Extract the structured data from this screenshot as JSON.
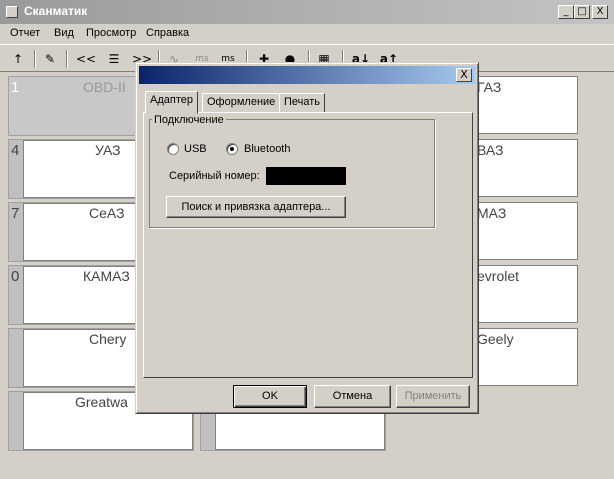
{
  "app": {
    "title": "Сканматик",
    "caption_buttons": [
      "_",
      "□",
      "X"
    ]
  },
  "menu": [
    "Отчет",
    "Вид",
    "Просмотр",
    "Справка"
  ],
  "toolbar": [
    {
      "icon": "up-arrow-icon",
      "glyph": "↑"
    },
    {
      "icon": "edit-icon",
      "glyph": "✎"
    },
    {
      "icon": "prev-icon",
      "glyph": "<<"
    },
    {
      "icon": "list-icon",
      "glyph": "☰"
    },
    {
      "icon": "next-icon",
      "glyph": ">>"
    },
    {
      "icon": "graph-icon",
      "glyph": "∿"
    },
    {
      "icon": "ms-icon",
      "glyph": "ms"
    },
    {
      "icon": "ms2-icon",
      "glyph": "ms"
    },
    {
      "icon": "plus-icon",
      "glyph": "✚"
    },
    {
      "icon": "record-icon",
      "glyph": "●"
    },
    {
      "icon": "chart-icon",
      "glyph": "▦"
    },
    {
      "icon": "font-decrease-icon",
      "glyph": "a↓"
    },
    {
      "icon": "font-increase-icon",
      "glyph": "a↑"
    }
  ],
  "tiles": {
    "left": [
      {
        "num": "1",
        "label": "OBD-II",
        "dim": true
      },
      {
        "num": "4",
        "label": "УАЗ"
      },
      {
        "num": "7",
        "label": "СеАЗ"
      },
      {
        "num": "0",
        "label": "КАМАЗ"
      },
      {
        "num": "",
        "label": "Chery"
      },
      {
        "num": "",
        "label": "Greatwa"
      }
    ],
    "right": [
      {
        "label": "ГАЗ"
      },
      {
        "label": "ВАЗ"
      },
      {
        "label": "МАЗ"
      },
      {
        "label": "evrolet"
      },
      {
        "label": "Geely"
      },
      {
        "label": ""
      }
    ]
  },
  "dialog": {
    "close": "X",
    "tabs": [
      "Адаптер",
      "Оформление",
      "Печать"
    ],
    "group_title": "Подключение",
    "usb_label": "USB",
    "bluetooth_label": "Bluetooth",
    "selected": "Bluetooth",
    "serial_label": "Серийный номер:",
    "search_button": "Поиск и привязка адаптера...",
    "ok": "OK",
    "cancel": "Отмена",
    "apply": "Применить"
  }
}
